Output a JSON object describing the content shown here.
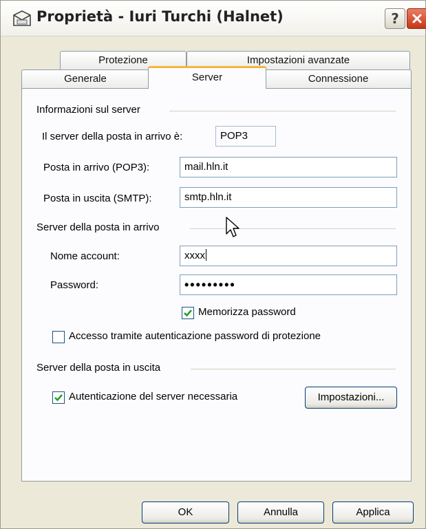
{
  "window": {
    "title": "Proprietà - Iuri Turchi (Halnet)",
    "help_label": "?",
    "close_icon": "close-icon"
  },
  "tabs": {
    "row1": [
      "Protezione",
      "Impostazioni avanzate"
    ],
    "row2": [
      "Generale",
      "Server",
      "Connessione"
    ],
    "active": "Server"
  },
  "server_info": {
    "group_title": "Informazioni sul server",
    "incoming_type_label": "Il server della posta in arrivo è:",
    "incoming_type_value": "POP3",
    "incoming_label": "Posta in arrivo (POP3):",
    "incoming_value": "mail.hln.it",
    "outgoing_label": "Posta in uscita (SMTP):",
    "outgoing_value": "smtp.hln.it"
  },
  "incoming_server": {
    "group_title": "Server della posta in arrivo",
    "account_label": "Nome account:",
    "account_value": "xxxx",
    "password_label": "Password:",
    "password_value": "•••••••••",
    "remember_password_label": "Memorizza password",
    "remember_password_checked": true,
    "spa_label": "Accesso tramite autenticazione password di protezione",
    "spa_checked": false
  },
  "outgoing_server": {
    "group_title": "Server della posta in uscita",
    "auth_label": "Autenticazione del server necessaria",
    "auth_checked": true,
    "settings_button": "Impostazioni..."
  },
  "footer": {
    "ok": "OK",
    "cancel": "Annulla",
    "apply": "Applica"
  },
  "colors": {
    "accent_tab": "#f6b43a",
    "close_button": "#c63616",
    "check": "#21a121"
  }
}
